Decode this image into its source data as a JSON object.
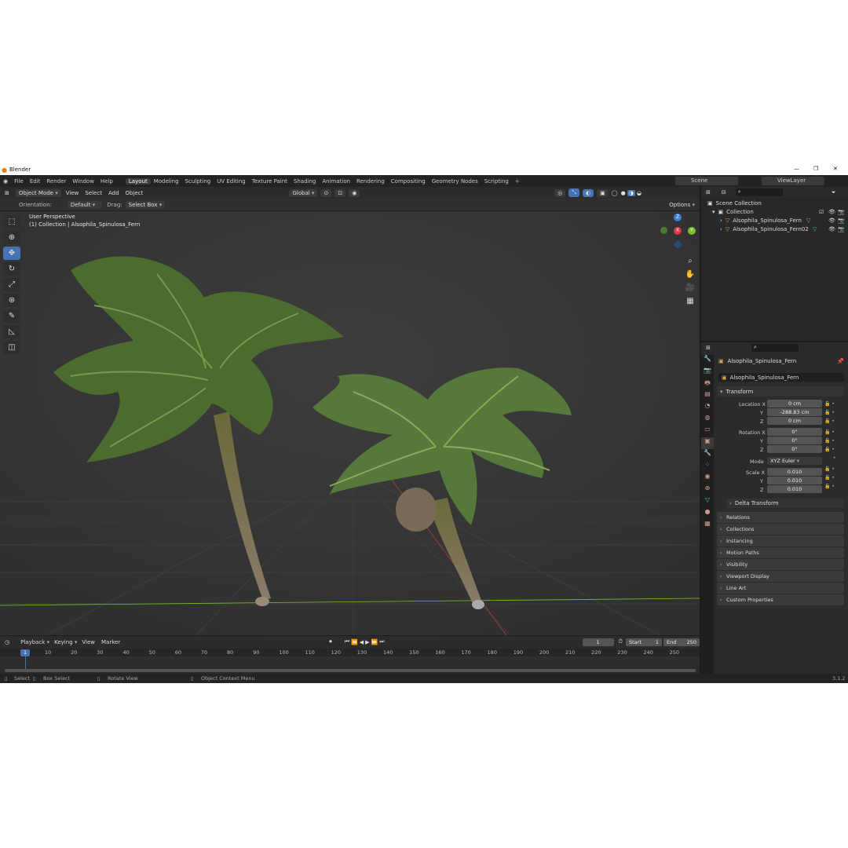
{
  "top_tab": "",
  "window": {
    "title": "Blender",
    "controls": [
      "—",
      "❐",
      "✕"
    ]
  },
  "menu": [
    "File",
    "Edit",
    "Render",
    "Window",
    "Help"
  ],
  "workspaces": [
    "Layout",
    "Modeling",
    "Sculpting",
    "UV Editing",
    "Texture Paint",
    "Shading",
    "Animation",
    "Rendering",
    "Compositing",
    "Geometry Nodes",
    "Scripting"
  ],
  "scene": {
    "scene_label": "Scene",
    "view_layer_label": "ViewLayer"
  },
  "viewport_header": {
    "mode": "Object Mode",
    "menus": [
      "View",
      "Select",
      "Add",
      "Object"
    ],
    "transform": "Global"
  },
  "tool_settings": {
    "orientation_label": "Orientation:",
    "orientation_value": "Default",
    "drag_label": "Drag:",
    "drag_value": "Select Box",
    "options": "Options"
  },
  "viewport": {
    "perspective": "User Perspective",
    "collection_info": "(1) Collection | Alsophila_Spinulosa_Fern",
    "gizmo": {
      "z": "Z",
      "x": "X",
      "y": "Y"
    }
  },
  "outliner": {
    "scene_collection": "Scene Collection",
    "collection": "Collection",
    "objects": [
      "Alsophila_Spinulosa_Fern",
      "Alsophila_Spinulosa_Fern02"
    ]
  },
  "properties": {
    "object_name": "Alsophila_Spinulosa_Fern",
    "datablock": "Alsophila_Spinulosa_Fern",
    "transform_title": "Transform",
    "location": {
      "label": "Location X",
      "x": "0 cm",
      "y": "-288.83 cm",
      "z": "0 cm"
    },
    "rotation": {
      "label": "Rotation X",
      "x": "0°",
      "y": "0°",
      "z": "0°"
    },
    "mode": {
      "label": "Mode",
      "value": "XYZ Euler"
    },
    "scale": {
      "label": "Scale X",
      "x": "0.010",
      "y": "0.010",
      "z": "0.010"
    },
    "axis_y": "Y",
    "axis_z": "Z",
    "delta": "Delta Transform",
    "panels": [
      "Relations",
      "Collections",
      "Instancing",
      "Motion Paths",
      "Visibility",
      "Viewport Display",
      "Line Art",
      "Custom Properties"
    ]
  },
  "timeline": {
    "menus": [
      "Playback",
      "Keying",
      "View",
      "Marker"
    ],
    "current_frame": "1",
    "start_label": "Start",
    "start": "1",
    "end_label": "End",
    "end": "250",
    "cursor_frame": "1",
    "ticks": [
      "10",
      "20",
      "30",
      "40",
      "50",
      "60",
      "70",
      "80",
      "90",
      "100",
      "110",
      "120",
      "130",
      "140",
      "150",
      "160",
      "170",
      "180",
      "190",
      "200",
      "210",
      "220",
      "230",
      "240",
      "250"
    ]
  },
  "statusbar": {
    "items": [
      "Select",
      "Box Select",
      "Rotate View",
      "Object Context Menu"
    ],
    "version": "3.1.2"
  },
  "colors": {
    "active": "#4772b3",
    "x_axis": "#d8394a",
    "y_axis": "#7bbd2c",
    "z_axis": "#3b7fd6"
  }
}
